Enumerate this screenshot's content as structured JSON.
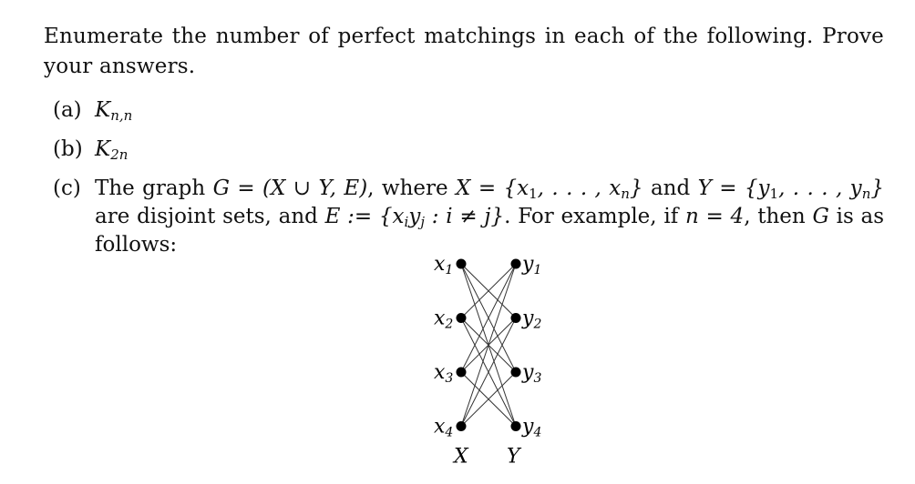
{
  "intro": "Enumerate the number of perfect matchings in each of the following. Prove your answers.",
  "items": [
    {
      "label": "(a)",
      "math_base": "K",
      "math_sub": "n,n"
    },
    {
      "label": "(b)",
      "math_base": "K",
      "math_sub": "2n"
    },
    {
      "label": "(c)",
      "text_1": "The graph ",
      "math_g": "G = (X ∪ Y, E)",
      "text_2": ", where ",
      "math_x": "X = {x",
      "sub_1": "1",
      "math_x_mid": ", . . . , x",
      "sub_n": "n",
      "math_x_end": "}",
      "text_3": " and ",
      "math_y": "Y = {y",
      "math_y_mid": ", . . . , y",
      "math_y_end": "}",
      "text_4": " are disjoint sets, and ",
      "math_e": "E := {x",
      "sub_i": "i",
      "math_e_y": "y",
      "sub_j": "j",
      "math_e_end": " : i ≠ j}",
      "text_5": ". For example, if ",
      "math_n": "n = 4",
      "text_6": ", then ",
      "math_g2": "G",
      "text_7": " is as follows:"
    }
  ],
  "graph": {
    "n": 4,
    "left_nodes": [
      {
        "base": "x",
        "sub": "1"
      },
      {
        "base": "x",
        "sub": "2"
      },
      {
        "base": "x",
        "sub": "3"
      },
      {
        "base": "x",
        "sub": "4"
      }
    ],
    "right_nodes": [
      {
        "base": "y",
        "sub": "1"
      },
      {
        "base": "y",
        "sub": "2"
      },
      {
        "base": "y",
        "sub": "3"
      },
      {
        "base": "y",
        "sub": "4"
      }
    ],
    "edges_rule": "i != j",
    "left_set_label": "X",
    "right_set_label": "Y"
  }
}
